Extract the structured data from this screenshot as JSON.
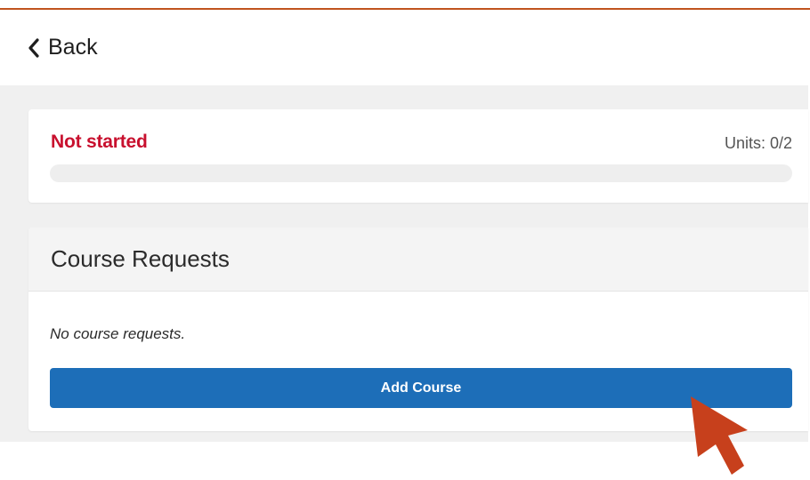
{
  "header": {
    "back_label": "Back",
    "back_icon": "chevron-left-icon"
  },
  "progress": {
    "status": "Not started",
    "units_label": "Units: 0/2",
    "fraction_complete": 0
  },
  "course_requests": {
    "title": "Course Requests",
    "empty_message": "No course requests.",
    "add_button_label": "Add Course"
  },
  "colors": {
    "accent_top_border": "#c0541e",
    "status_not_started": "#c8102e",
    "primary_button": "#1d6eb8",
    "pointer_arrow": "#c7401c"
  }
}
